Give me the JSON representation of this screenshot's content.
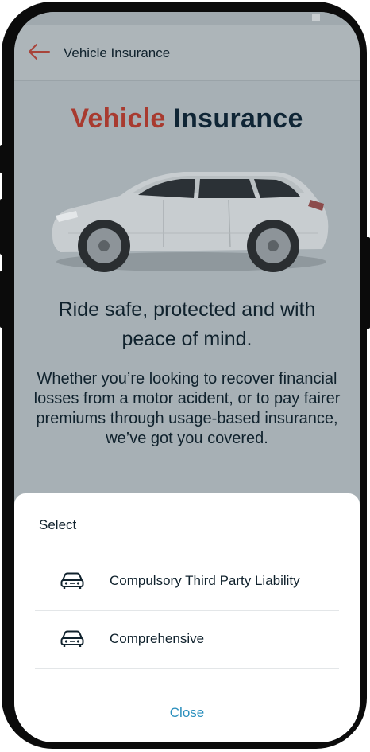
{
  "appbar": {
    "title": "Vehicle Insurance"
  },
  "hero": {
    "title_part1": "Vehicle",
    "title_part2": "Insurance",
    "tagline": "Ride safe, protected and with peace of mind.",
    "description": "Whether you’re looking to recover financial losses from a motor acident, or to pay fairer premiums through usage-based insurance, we’ve got you covered."
  },
  "sheet": {
    "title": "Select",
    "options": [
      {
        "label": "Compulsory Third Party Liability",
        "icon": "car-icon"
      },
      {
        "label": "Comprehensive",
        "icon": "car-icon"
      }
    ],
    "close_label": "Close"
  },
  "colors": {
    "accent_red": "#a83a2f",
    "navy": "#0f2535",
    "link_blue": "#2a8fbd",
    "overlay": "#a7b0b5"
  }
}
